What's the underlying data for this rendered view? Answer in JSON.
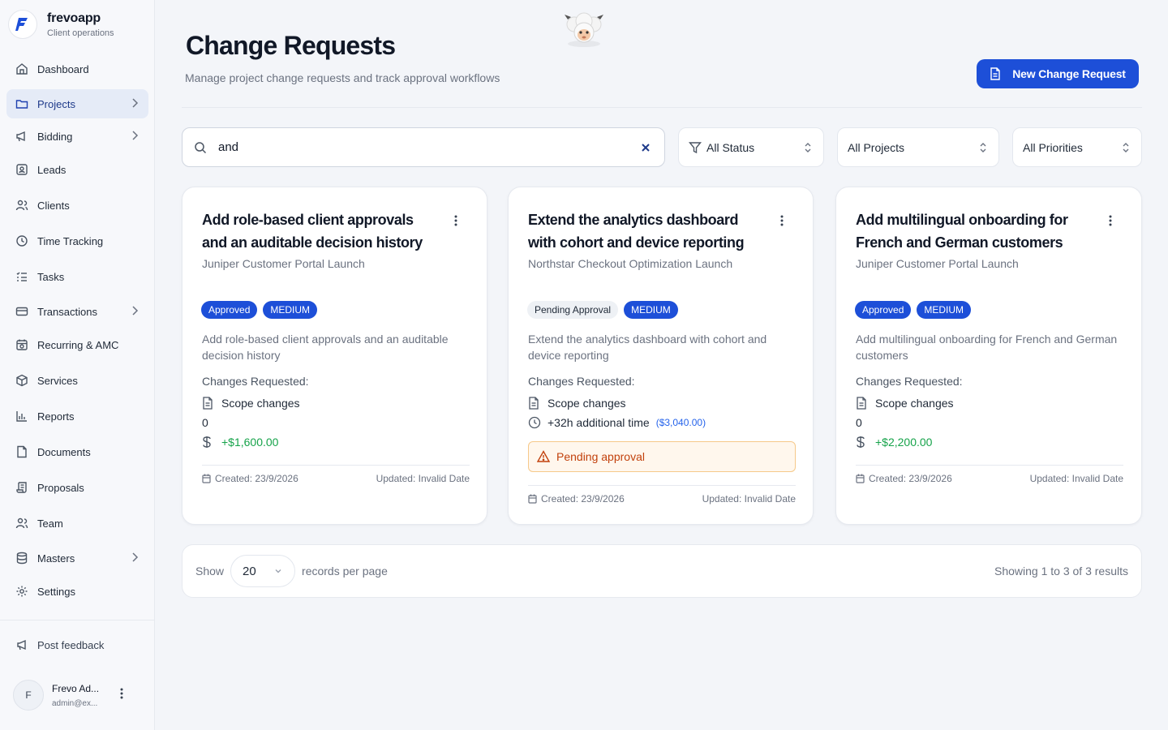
{
  "brand": {
    "name": "frevoapp",
    "subtitle": "Client operations"
  },
  "sidebar": {
    "items": [
      {
        "label": "Dashboard",
        "icon": "home-icon",
        "has_chevron": false
      },
      {
        "label": "Projects",
        "icon": "folder-icon",
        "has_chevron": true,
        "active": true
      },
      {
        "label": "Bidding",
        "icon": "megaphone-icon",
        "has_chevron": true
      },
      {
        "label": "Leads",
        "icon": "contact-icon",
        "has_chevron": false
      },
      {
        "label": "Clients",
        "icon": "users-icon",
        "has_chevron": false
      },
      {
        "label": "Time Tracking",
        "icon": "clock-icon",
        "has_chevron": false
      },
      {
        "label": "Tasks",
        "icon": "list-icon",
        "has_chevron": false
      },
      {
        "label": "Transactions",
        "icon": "card-icon",
        "has_chevron": true
      },
      {
        "label": "Recurring & AMC",
        "icon": "calendar-repeat-icon",
        "has_chevron": false
      },
      {
        "label": "Services",
        "icon": "box-icon",
        "has_chevron": false
      },
      {
        "label": "Reports",
        "icon": "bar-chart-icon",
        "has_chevron": false
      },
      {
        "label": "Documents",
        "icon": "file-icon",
        "has_chevron": false
      },
      {
        "label": "Proposals",
        "icon": "scroll-icon",
        "has_chevron": false
      },
      {
        "label": "Team",
        "icon": "team-icon",
        "has_chevron": false
      },
      {
        "label": "Masters",
        "icon": "database-icon",
        "has_chevron": true
      },
      {
        "label": "Settings",
        "icon": "gear-icon",
        "has_chevron": false
      }
    ],
    "feedback_label": "Post feedback",
    "user": {
      "initial": "F",
      "name": "Frevo Ad...",
      "email": "admin@ex..."
    }
  },
  "header": {
    "title": "Change Requests",
    "subtitle": "Manage project change requests and track approval workflows",
    "new_button": "New Change Request"
  },
  "filters": {
    "search_value": "and",
    "status": "All Status",
    "projects": "All Projects",
    "priorities": "All Priorities"
  },
  "cards": [
    {
      "title": "Add role-based client approvals and an auditable decision history",
      "project": "Juniper Customer Portal Launch",
      "status": "Approved",
      "priority": "MEDIUM",
      "description": "Add role-based client approvals and an auditable decision history",
      "changes_label": "Changes Requested:",
      "scope": "Scope changes",
      "hours": "0",
      "amount": "+$1,600.00",
      "created": "Created: 23/9/2026",
      "updated": "Updated: Invalid Date"
    },
    {
      "title": "Extend the analytics dashboard with cohort and device reporting",
      "project": "Northstar Checkout Optimization Launch",
      "status": "Pending Approval",
      "priority": "MEDIUM",
      "description": "Extend the analytics dashboard with cohort and device reporting",
      "changes_label": "Changes Requested:",
      "scope": "Scope changes",
      "time": "+32h additional time",
      "time_cost": "($3,040.00)",
      "warning": "Pending approval",
      "created": "Created: 23/9/2026",
      "updated": "Updated: Invalid Date"
    },
    {
      "title": "Add multilingual onboarding for French and German customers",
      "project": "Juniper Customer Portal Launch",
      "status": "Approved",
      "priority": "MEDIUM",
      "description": "Add multilingual onboarding for French and German customers",
      "changes_label": "Changes Requested:",
      "scope": "Scope changes",
      "hours": "0",
      "amount": "+$2,200.00",
      "created": "Created: 23/9/2026",
      "updated": "Updated: Invalid Date"
    }
  ],
  "pagination": {
    "show_label": "Show",
    "per_page": "20",
    "records_label": "records per page",
    "results": "Showing 1 to 3 of 3 results"
  },
  "colors": {
    "primary": "#1d4fd8",
    "money_green": "#16a34a",
    "warning_text": "#c2410c",
    "warning_bg": "#fff7ed"
  }
}
